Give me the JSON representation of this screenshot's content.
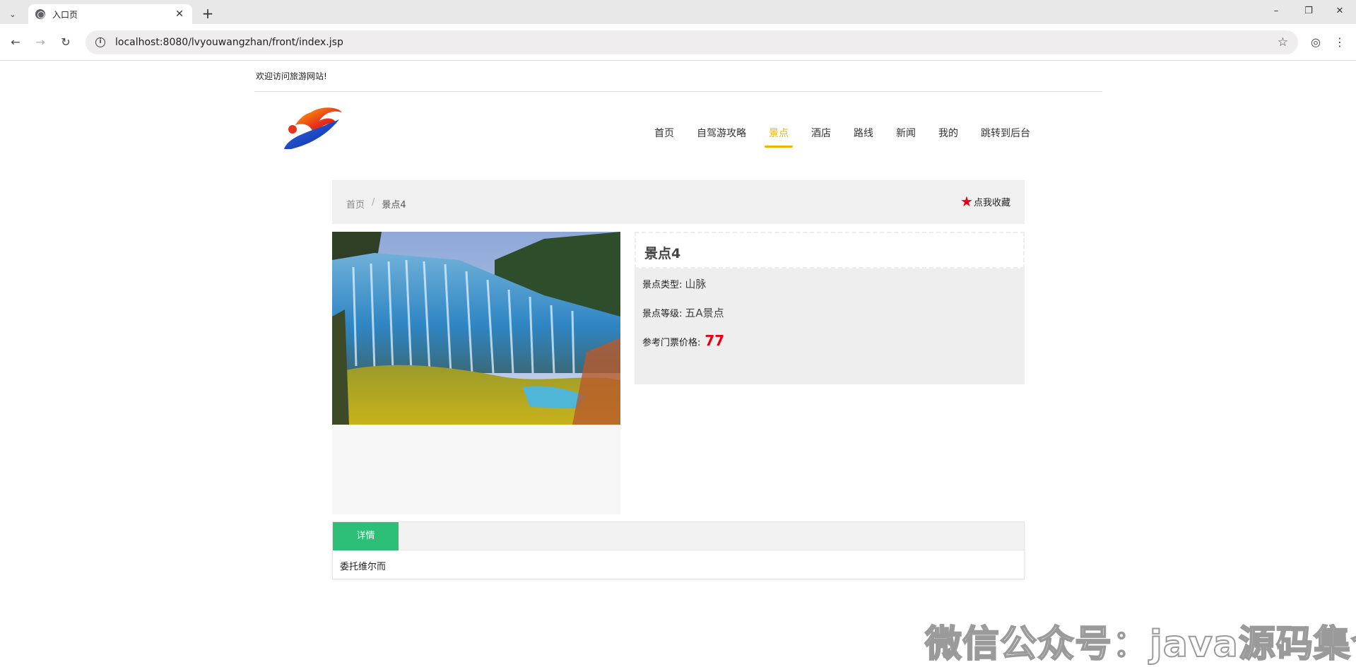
{
  "browser": {
    "tab_title": "入口页",
    "tab_close": "✕",
    "new_tab": "+",
    "url": "localhost:8080/lvyouwangzhan/front/index.jsp",
    "window_controls": [
      "–",
      "❐",
      "✕"
    ]
  },
  "site": {
    "welcome": "欢迎访问旅游网站!",
    "nav": [
      "首页",
      "自驾游攻略",
      "景点",
      "酒店",
      "路线",
      "新闻",
      "我的",
      "跳转到后台"
    ],
    "active_nav": "景点"
  },
  "breadcrumb": {
    "home": "首页",
    "separator": "/",
    "current": "景点4"
  },
  "favorite": {
    "label": "点我收藏",
    "star_color": "#e60012"
  },
  "attraction": {
    "title": "景点4",
    "type_label": "景点类型:",
    "type_value": "山脉",
    "level_label": "景点等级:",
    "level_value": "五A景点",
    "price_label": "参考门票价格:",
    "price_value": "77"
  },
  "detail": {
    "tab_label": "详情",
    "content": "委托维尔而"
  },
  "watermark": "微信公众号：java源码集合",
  "colors": {
    "accent": "#f0b400",
    "tab_green": "#2dbf78",
    "price_red": "#e60012"
  }
}
